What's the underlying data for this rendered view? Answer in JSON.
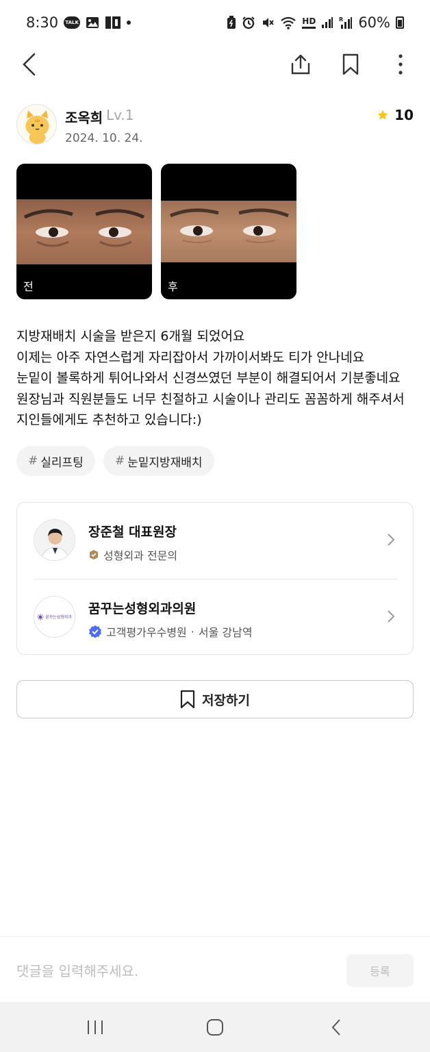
{
  "status_bar": {
    "time": "8:30",
    "talk_badge": "TALK",
    "hd_badge": "HD",
    "battery_pct": "60%",
    "left_icons": [
      "kakaotalk-icon",
      "gallery-icon",
      "app-icon",
      "more-dot-icon"
    ],
    "right_icons": [
      "battery-saver-icon",
      "alarm-icon",
      "mute-icon",
      "wifi-icon",
      "hd-voice-icon",
      "signal-icon",
      "signal-roaming-icon",
      "battery-icon"
    ]
  },
  "app_bar": {
    "icons": [
      "back-icon",
      "share-icon",
      "bookmark-icon",
      "more-vertical-icon"
    ]
  },
  "author": {
    "name": "조옥희",
    "level": "Lv.1",
    "date": "2024. 10. 24.",
    "rating": "10",
    "avatar_icon": "cat-avatar-icon"
  },
  "photos": [
    {
      "label": "전"
    },
    {
      "label": "후"
    }
  ],
  "review": {
    "lines": [
      "지방재배치 시술을 받은지 6개월 되었어요",
      "이제는 아주 자연스럽게 자리잡아서 가까이서봐도 티가 안나네요",
      "눈밑이 볼록하게 튀어나와서 신경쓰였던 부분이 해결되어서 기분좋네요",
      "원장님과 직원분들도 너무 친절하고 시술이나 관리도 꼼꼼하게 해주셔서",
      "지인들에게도 추천하고 있습니다:)"
    ]
  },
  "tags": [
    {
      "hash": "#",
      "label": "실리프팅"
    },
    {
      "hash": "#",
      "label": "눈밑지방재배치"
    }
  ],
  "doctor": {
    "name": "장준철 대표원장",
    "specialty": "성형외과 전문의"
  },
  "clinic": {
    "name": "꿈꾸는성형외과의원",
    "logo_text": "꿈꾸는성형외과",
    "badge": "고객평가우수병원",
    "separator": "·",
    "location": "서울 강남역"
  },
  "save_button": {
    "label": "저장하기"
  },
  "comment": {
    "placeholder": "댓글을 입력해주세요.",
    "submit": "등록"
  },
  "nav": {
    "icons": [
      "recent-apps-icon",
      "home-icon",
      "nav-back-icon"
    ]
  },
  "colors": {
    "star": "#f5c518",
    "verified": "#4a6cf7",
    "specialist_badge": "#b08a5a",
    "clinic_logo": "#6b4aa8"
  }
}
